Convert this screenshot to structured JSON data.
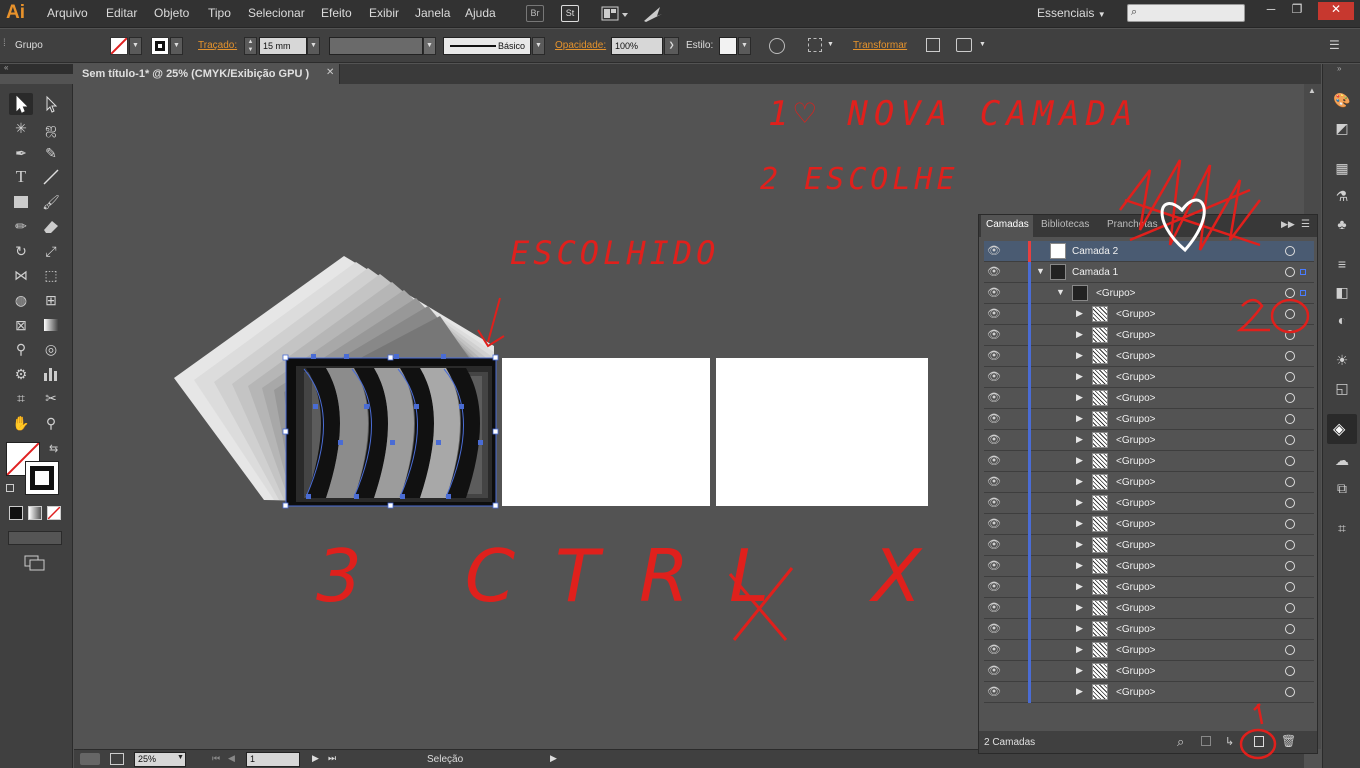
{
  "app": {
    "logo": "Ai",
    "brand_color": "#e8922b"
  },
  "menu": [
    "Arquivo",
    "Editar",
    "Objeto",
    "Tipo",
    "Selecionar",
    "Efeito",
    "Exibir",
    "Janela",
    "Ajuda"
  ],
  "menu_buttons": {
    "bridge": "Br",
    "stock": "St"
  },
  "workspace": {
    "label": "Essenciais"
  },
  "window_controls": {
    "minimize": "─",
    "restore": "❐",
    "close": "✕"
  },
  "control_bar": {
    "selection_label": "Grupo",
    "stroke_label": "Traçado:",
    "stroke_value": "15 mm",
    "brush_label": "Básico",
    "opacity_label": "Opacidade:",
    "opacity_value": "100%",
    "style_label": "Estilo:",
    "transform_label": "Transformar"
  },
  "document": {
    "tab_title": "Sem título-1* @ 25% (CMYK/Exibição GPU )",
    "close": "✕"
  },
  "annotations": {
    "step1": "1♡ NOVA CAMADA",
    "step2": "2 ESCOLHE",
    "chosen": "ESCOLHIDO",
    "step3": "3 CTRL X",
    "mark_twenty": "20",
    "mark_one": "1",
    "color": "#e0201c"
  },
  "status_bar": {
    "zoom": "25%",
    "artboard": "1",
    "tool": "Seleção"
  },
  "layers_panel": {
    "tabs": [
      "Camadas",
      "Bibliotecas",
      "Pranchetas"
    ],
    "layer_count": "2 Camadas",
    "rows": [
      {
        "name": "Camada 2",
        "level": 0,
        "color": "#e74040",
        "expand": "",
        "selected": true
      },
      {
        "name": "Camada 1",
        "level": 0,
        "color": "#4a6cd4",
        "expand": "▼",
        "selected": false
      },
      {
        "name": "<Grupo>",
        "level": 1,
        "color": "#4a6cd4",
        "expand": "▼",
        "selected": false
      },
      {
        "name": "<Grupo>",
        "level": 2,
        "color": "#4a6cd4",
        "expand": "▶",
        "selected": false
      },
      {
        "name": "<Grupo>",
        "level": 2,
        "color": "#4a6cd4",
        "expand": "▶",
        "selected": false
      },
      {
        "name": "<Grupo>",
        "level": 2,
        "color": "#4a6cd4",
        "expand": "▶",
        "selected": false
      },
      {
        "name": "<Grupo>",
        "level": 2,
        "color": "#4a6cd4",
        "expand": "▶",
        "selected": false
      },
      {
        "name": "<Grupo>",
        "level": 2,
        "color": "#4a6cd4",
        "expand": "▶",
        "selected": false
      },
      {
        "name": "<Grupo>",
        "level": 2,
        "color": "#4a6cd4",
        "expand": "▶",
        "selected": false
      },
      {
        "name": "<Grupo>",
        "level": 2,
        "color": "#4a6cd4",
        "expand": "▶",
        "selected": false
      },
      {
        "name": "<Grupo>",
        "level": 2,
        "color": "#4a6cd4",
        "expand": "▶",
        "selected": false
      },
      {
        "name": "<Grupo>",
        "level": 2,
        "color": "#4a6cd4",
        "expand": "▶",
        "selected": false
      },
      {
        "name": "<Grupo>",
        "level": 2,
        "color": "#4a6cd4",
        "expand": "▶",
        "selected": false
      },
      {
        "name": "<Grupo>",
        "level": 2,
        "color": "#4a6cd4",
        "expand": "▶",
        "selected": false
      },
      {
        "name": "<Grupo>",
        "level": 2,
        "color": "#4a6cd4",
        "expand": "▶",
        "selected": false
      },
      {
        "name": "<Grupo>",
        "level": 2,
        "color": "#4a6cd4",
        "expand": "▶",
        "selected": false
      },
      {
        "name": "<Grupo>",
        "level": 2,
        "color": "#4a6cd4",
        "expand": "▶",
        "selected": false
      },
      {
        "name": "<Grupo>",
        "level": 2,
        "color": "#4a6cd4",
        "expand": "▶",
        "selected": false
      },
      {
        "name": "<Grupo>",
        "level": 2,
        "color": "#4a6cd4",
        "expand": "▶",
        "selected": false
      },
      {
        "name": "<Grupo>",
        "level": 2,
        "color": "#4a6cd4",
        "expand": "▶",
        "selected": false
      },
      {
        "name": "<Grupo>",
        "level": 2,
        "color": "#4a6cd4",
        "expand": "▶",
        "selected": false
      },
      {
        "name": "<Grupo>",
        "level": 2,
        "color": "#4a6cd4",
        "expand": "▶",
        "selected": false
      }
    ]
  }
}
